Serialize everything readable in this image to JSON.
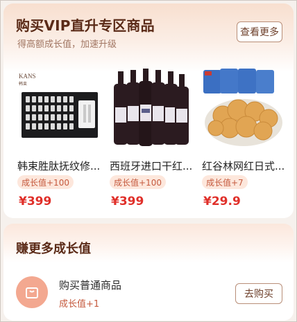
{
  "vip_section": {
    "title": "购买VIP直升专区商品",
    "subtitle": "得高额成长值，加速升级",
    "see_more_label": "查看更多",
    "products": [
      {
        "name": "韩束胜肽抚纹修...",
        "growth": "成长值+100",
        "price": "¥399",
        "image_icon": "skincare-ampoule-box"
      },
      {
        "name": "西班牙进口干红...",
        "growth": "成长值+100",
        "price": "¥399",
        "image_icon": "wine-bottles"
      },
      {
        "name": "红谷林网红日式...",
        "growth": "成长值+7",
        "price": "¥29.9",
        "image_icon": "cookies-plate"
      }
    ]
  },
  "earn_section": {
    "title": "赚更多成长值",
    "task": {
      "title": "购买普通商品",
      "reward": "成长值+1",
      "button_label": "去购买",
      "icon": "shopping-bag-icon"
    }
  },
  "colors": {
    "title_brown": "#5a2a17",
    "price_red": "#e0302a",
    "badge_bg": "#fde7dc",
    "icon_orange": "#f3a890"
  },
  "brand_marks": {
    "kans_logo": "KANS",
    "kans_sub": "韩束"
  }
}
